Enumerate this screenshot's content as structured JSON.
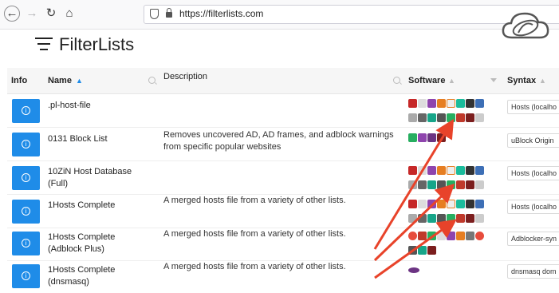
{
  "browser": {
    "url": "https://filterlists.com"
  },
  "header": {
    "title": "FilterLists"
  },
  "table": {
    "columns": {
      "info": "Info",
      "name": "Name",
      "description": "Description",
      "software": "Software",
      "syntax": "Syntax"
    },
    "rows": [
      {
        "name": ".pl-host-file",
        "description": "",
        "syntax": "Hosts (localho"
      },
      {
        "name": "0131 Block List",
        "description": "Removes uncovered AD, AD frames, and adblock warnings from specific popular websites",
        "syntax": "uBlock Origin"
      },
      {
        "name": "10ZiN Host Database (Full)",
        "description": "",
        "syntax": "Hosts (localho"
      },
      {
        "name": "1Hosts Complete",
        "description": "A merged hosts file from a variety of other lists.",
        "syntax": "Hosts (localho"
      },
      {
        "name": "1Hosts Complete (Adblock Plus)",
        "description": "A merged hosts file from a variety of other lists.",
        "syntax": "Adblocker-syn"
      },
      {
        "name": "1Hosts Complete (dnsmasq)",
        "description": "A merged hosts file from a variety of other lists.",
        "syntax": "dnsmasq dom"
      }
    ]
  },
  "colors": {
    "info_button": "#1f8ce8",
    "annotation_arrow": "#e8432a"
  }
}
